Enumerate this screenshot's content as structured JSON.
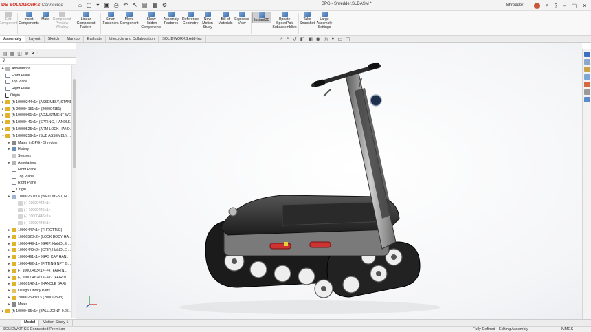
{
  "titlebar": {
    "brand_logo": "DS",
    "brand_product": "SOLIDWORKS",
    "brand_suffix": "Connected",
    "document_title": "BPG - Shredder.SLDASM *",
    "user": "Shredder"
  },
  "ribbon": {
    "buttons": [
      {
        "label": "Edit Component",
        "disabled": true
      },
      {
        "label": "Insert Components",
        "disabled": false
      },
      {
        "label": "Mate",
        "disabled": false
      },
      {
        "label": "Component Preview Window",
        "disabled": true
      },
      {
        "label": "Linear Component Pattern",
        "disabled": false
      },
      {
        "label": "Smart Fasteners",
        "disabled": false
      },
      {
        "label": "Move Component",
        "disabled": false
      },
      {
        "label": "Show Hidden Components",
        "disabled": false
      },
      {
        "label": "Assembly Features",
        "disabled": false
      },
      {
        "label": "Reference Geometry",
        "disabled": false
      },
      {
        "label": "New Motion Study",
        "disabled": false
      },
      {
        "label": "Bill of Materials",
        "disabled": false
      },
      {
        "label": "Exploded View",
        "disabled": false
      },
      {
        "label": "Instant3D",
        "disabled": false,
        "active": true
      },
      {
        "label": "Update SpeedPak Subassemblies",
        "disabled": false
      },
      {
        "label": "Take Snapshot",
        "disabled": false
      },
      {
        "label": "Large Assembly Settings",
        "disabled": false
      }
    ]
  },
  "tabs": [
    "Assembly",
    "Layout",
    "Sketch",
    "Markup",
    "Evaluate",
    "Lifecycle and Collaboration",
    "SOLIDWORKS Add-Ins"
  ],
  "tree": [
    {
      "label": "Annotations",
      "icon": "ann",
      "indent": 0,
      "arrow": "►"
    },
    {
      "label": "Front Plane",
      "icon": "plane",
      "indent": 0,
      "arrow": ""
    },
    {
      "label": "Top Plane",
      "icon": "plane",
      "indent": 0,
      "arrow": ""
    },
    {
      "label": "Right Plane",
      "icon": "plane",
      "indent": 0,
      "arrow": ""
    },
    {
      "label": "Origin",
      "icon": "org",
      "indent": 0,
      "arrow": ""
    },
    {
      "label": "(f) 10000244<1> (ASSEMBLY, STAND...",
      "icon": "asm",
      "indent": 0,
      "arrow": "►"
    },
    {
      "label": "(f) 200004151<1> (200004151)",
      "icon": "asm",
      "indent": 0,
      "arrow": "►"
    },
    {
      "label": "(f) 10000061<1> (ADJUSTMENT WE...",
      "icon": "asm",
      "indent": 0,
      "arrow": "►"
    },
    {
      "label": "(f) 10000441<1> (SPRING, HANDLE...",
      "icon": "asm",
      "indent": 0,
      "arrow": "►"
    },
    {
      "label": "(f) 10000525<1> (ARM LOCK HAND...",
      "icon": "asm",
      "indent": 0,
      "arrow": "►"
    },
    {
      "label": "(f) 10000259<1> (SUB ASSEMBLY, ...",
      "icon": "asm",
      "indent": 0,
      "arrow": "▼"
    },
    {
      "label": "Mates in BPG - Shredder",
      "icon": "mate",
      "indent": 1,
      "arrow": "►"
    },
    {
      "label": "History",
      "icon": "hist",
      "indent": 1,
      "arrow": "►"
    },
    {
      "label": "Sensors",
      "icon": "sens",
      "indent": 1,
      "arrow": ""
    },
    {
      "label": "Annotations",
      "icon": "ann",
      "indent": 1,
      "arrow": "►"
    },
    {
      "label": "Front Plane",
      "icon": "plane",
      "indent": 1,
      "arrow": ""
    },
    {
      "label": "Top Plane",
      "icon": "plane",
      "indent": 1,
      "arrow": ""
    },
    {
      "label": "Right Plane",
      "icon": "plane",
      "indent": 1,
      "arrow": ""
    },
    {
      "label": "Origin",
      "icon": "org",
      "indent": 1,
      "arrow": ""
    },
    {
      "label": "10000260<1> (WELDMENT, H...",
      "icon": "part",
      "indent": 1,
      "arrow": "►"
    },
    {
      "label": "(-) 10000444<1>",
      "icon": "part",
      "indent": 2,
      "arrow": "",
      "sup": true
    },
    {
      "label": "(-) 10000445<1>",
      "icon": "part",
      "indent": 2,
      "arrow": "",
      "sup": true
    },
    {
      "label": "(-) 10000446<1>",
      "icon": "part",
      "indent": 2,
      "arrow": "",
      "sup": true
    },
    {
      "label": "(-) 10000448<1>",
      "icon": "part",
      "indent": 2,
      "arrow": "",
      "sup": true
    },
    {
      "label": "10000447<1> (THROTTLE)",
      "icon": "asm",
      "indent": 1,
      "arrow": "►"
    },
    {
      "label": "10000528<2> (LOCK BODY HA...",
      "icon": "asm",
      "indent": 1,
      "arrow": "►"
    },
    {
      "label": "10000449<1> (GRIP, HANDLE ...",
      "icon": "asm",
      "indent": 1,
      "arrow": "►"
    },
    {
      "label": "10000449<2> (GRIP, HANDLE ...",
      "icon": "asm",
      "indent": 1,
      "arrow": "►"
    },
    {
      "label": "10000491<1> (GAS CAP HAN...",
      "icon": "asm",
      "indent": 1,
      "arrow": "►"
    },
    {
      "label": "10000492<1> (FITTING NPT G...",
      "icon": "asm",
      "indent": 1,
      "arrow": "►"
    },
    {
      "label": "(-) 10000463<1> ->x (FAIRIN...",
      "icon": "asm",
      "indent": 1,
      "arrow": "►"
    },
    {
      "label": "(-) 10000462<1> ->x? (FAIRIN...",
      "icon": "asm",
      "indent": 1,
      "arrow": "►"
    },
    {
      "label": "10000142<1> (HANDLE BAR)",
      "icon": "asm",
      "indent": 1,
      "arrow": "►"
    },
    {
      "label": "Design Library Parts",
      "icon": "folder",
      "indent": 1,
      "arrow": "►"
    },
    {
      "label": "20000259b<1> (20000259b)",
      "icon": "asm",
      "indent": 1,
      "arrow": "►"
    },
    {
      "label": "Mates",
      "icon": "mate",
      "indent": 1,
      "arrow": "►"
    },
    {
      "label": "(f) 10000495<1> (BALL JOINT, 0.25...",
      "icon": "asm",
      "indent": 0,
      "arrow": "►"
    }
  ],
  "bottom_tabs": [
    "Model",
    "Motion Study 1"
  ],
  "status": {
    "left": "SOLIDWORKS Connected Premium",
    "defined": "Fully Defined",
    "mode": "Editing Assembly",
    "units": "MMGS"
  },
  "colors": {
    "accent": "#d52b1e",
    "highlight": "#e1b22c"
  }
}
